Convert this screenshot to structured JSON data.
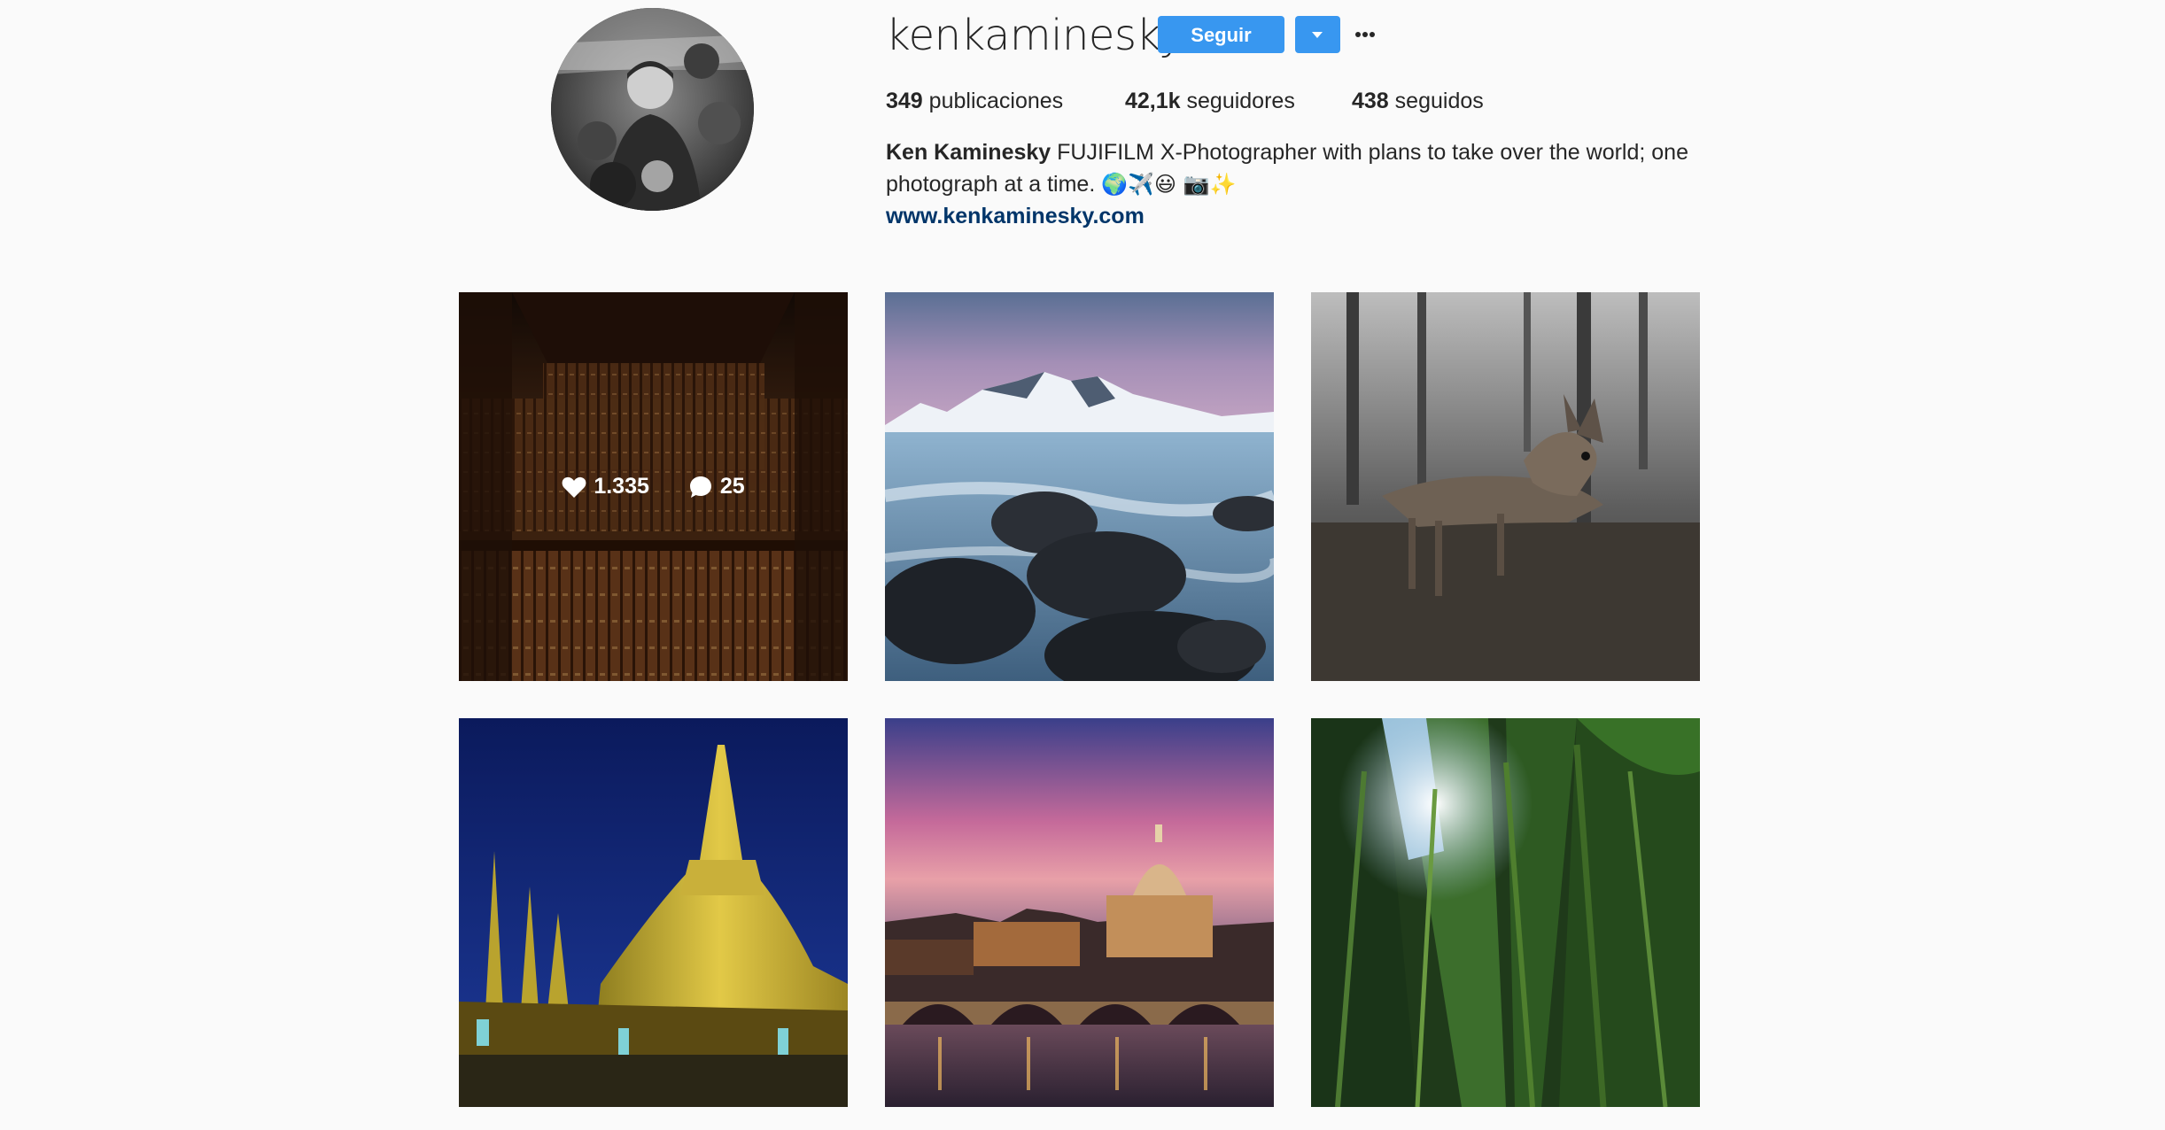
{
  "profile": {
    "username": "kenkaminesky",
    "follow_label": "Seguir",
    "dropdown_icon": "caret-down-icon",
    "more_icon": "ellipsis-icon",
    "stats": [
      {
        "value": "349",
        "label": "publicaciones"
      },
      {
        "value": "42,1k",
        "label": "seguidores"
      },
      {
        "value": "438",
        "label": "seguidos"
      }
    ],
    "full_name": "Ken Kaminesky",
    "bio_text": " FUJIFILM X-Photographer with plans to take over the world; one photograph at a time. ",
    "bio_emoji": "🌍✈️😃 📷✨",
    "website": "www.kenkaminesky.com"
  },
  "posts": [
    {
      "subject": "library bookshelves",
      "likes": "1.335",
      "comments": "25",
      "hovered": true
    },
    {
      "subject": "snowy mountains and rocky sea shore"
    },
    {
      "subject": "deer in forest, black and white"
    },
    {
      "subject": "golden pagoda at night"
    },
    {
      "subject": "St. Peter's Basilica and bridge at sunset"
    },
    {
      "subject": "bamboo forest looking up"
    }
  ],
  "colors": {
    "accent": "#3897f0",
    "link": "#003569",
    "background": "#fafafa",
    "text": "#262626"
  }
}
